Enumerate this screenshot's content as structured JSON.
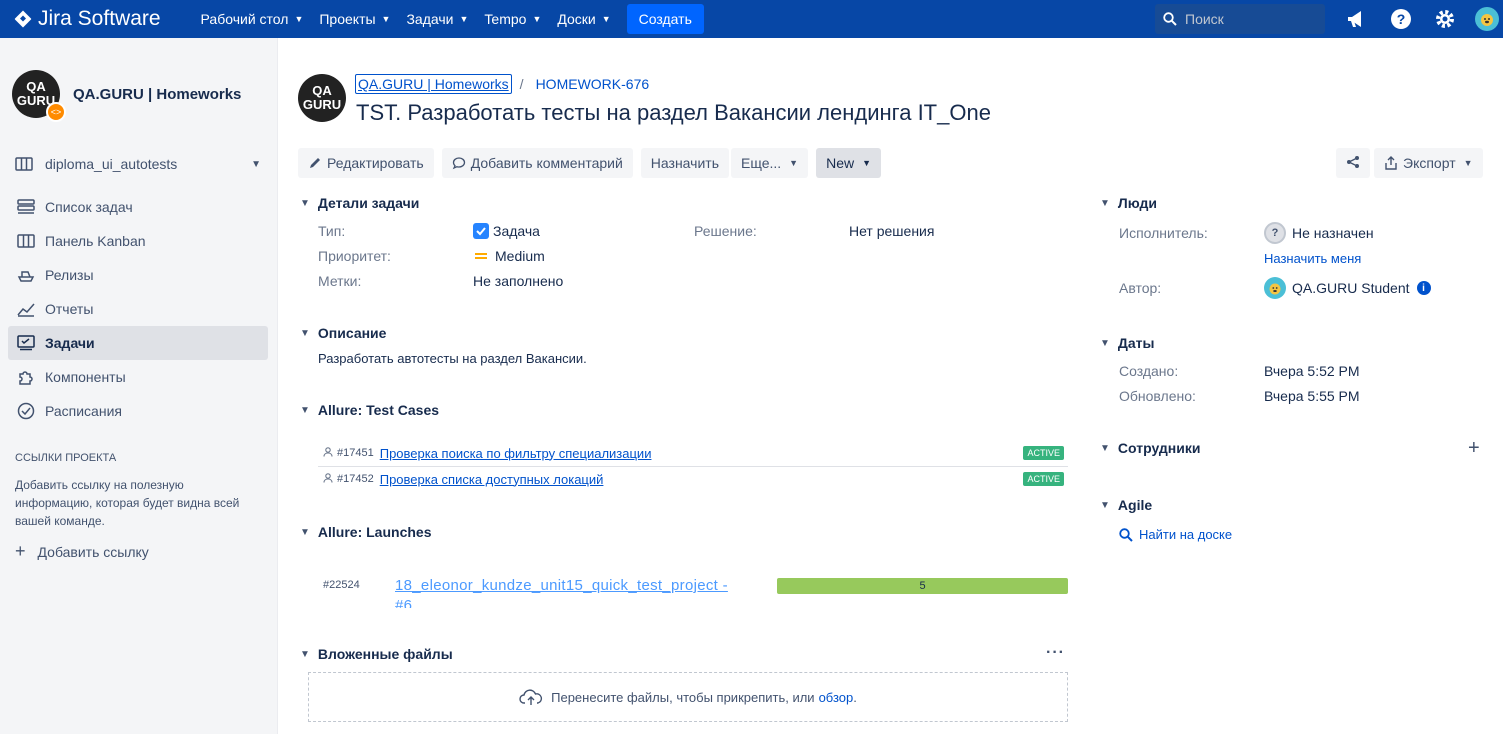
{
  "topnav": {
    "app_name": "Jira Software",
    "items": [
      {
        "label": "Рабочий стол"
      },
      {
        "label": "Проекты"
      },
      {
        "label": "Задачи"
      },
      {
        "label": "Tempo"
      },
      {
        "label": "Доски"
      }
    ],
    "create_label": "Создать",
    "search_placeholder": "Поиск"
  },
  "sidebar": {
    "project_name": "QA.GURU | Homeworks",
    "project_avatar_top": "QA",
    "project_avatar_bottom": "GURU",
    "board_name": "diploma_ui_autotests",
    "menu": [
      {
        "label": "Список задач",
        "icon": "backlog-icon"
      },
      {
        "label": "Панель Kanban",
        "icon": "board-icon"
      },
      {
        "label": "Релизы",
        "icon": "ship-icon"
      },
      {
        "label": "Отчеты",
        "icon": "chart-icon"
      },
      {
        "label": "Задачи",
        "icon": "issues-icon",
        "active": true
      },
      {
        "label": "Компоненты",
        "icon": "puzzle-icon"
      },
      {
        "label": "Расписания",
        "icon": "clock-icon"
      }
    ],
    "links_title": "ССЫЛКИ ПРОЕКТА",
    "links_text": "Добавить ссылку на полезную информацию, которая будет видна всей вашей команде.",
    "add_link_label": "Добавить ссылку"
  },
  "issue": {
    "breadcrumb_project": "QA.GURU | Homeworks",
    "breadcrumb_separator": "/",
    "key": "HOMEWORK-676",
    "title": "TST. Разработать тесты на раздел Вакансии лендинга IT_One"
  },
  "toolbar": {
    "edit_label": "Редактировать",
    "comment_label": "Добавить комментарий",
    "assign_label": "Назначить",
    "more_label": "Еще...",
    "status_label": "New",
    "export_label": "Экспорт"
  },
  "details": {
    "section_title": "Детали задачи",
    "type_label": "Тип:",
    "type_value": "Задача",
    "priority_label": "Приоритет:",
    "priority_value": "Medium",
    "labels_label": "Метки:",
    "labels_value": "Не заполнено",
    "resolution_label": "Решение:",
    "resolution_value": "Нет решения"
  },
  "description": {
    "section_title": "Описание",
    "text": "Разработать автотесты на раздел Вакансии."
  },
  "test_cases": {
    "section_title": "Allure: Test Cases",
    "items": [
      {
        "id": "#17451",
        "name": "Проверка поиска по фильтру специализации",
        "status": "ACTIVE"
      },
      {
        "id": "#17452",
        "name": "Проверка списка доступных локаций",
        "status": "ACTIVE"
      }
    ]
  },
  "launches": {
    "section_title": "Allure: Launches",
    "items": [
      {
        "id": "#22524",
        "name": "18_eleonor_kundze_unit15_quick_test_project - #6",
        "count": "5"
      }
    ]
  },
  "attachments": {
    "section_title": "Вложенные файлы",
    "more_label": "···",
    "drop_text": "Перенесите файлы, чтобы прикрепить, или",
    "browse_label": "обзор",
    "drop_suffix": "."
  },
  "people": {
    "section_title": "Люди",
    "assignee_label": "Исполнитель:",
    "assignee_value": "Не назначен",
    "assign_me_label": "Назначить меня",
    "reporter_label": "Автор:",
    "reporter_value": "QA.GURU Student"
  },
  "dates": {
    "section_title": "Даты",
    "created_label": "Создано:",
    "created_value": "Вчера 5:52 PM",
    "updated_label": "Обновлено:",
    "updated_value": "Вчера 5:55 PM"
  },
  "collaborators": {
    "section_title": "Сотрудники",
    "add_label": "+"
  },
  "agile": {
    "section_title": "Agile",
    "find_label": "Найти на доске"
  },
  "colors": {
    "nav_bg": "#0747a6",
    "create_btn": "#0065ff",
    "link": "#0052cc",
    "active_badge": "#36b37e",
    "launch_bar": "#97c95c",
    "priority_medium": "#ffab00"
  }
}
